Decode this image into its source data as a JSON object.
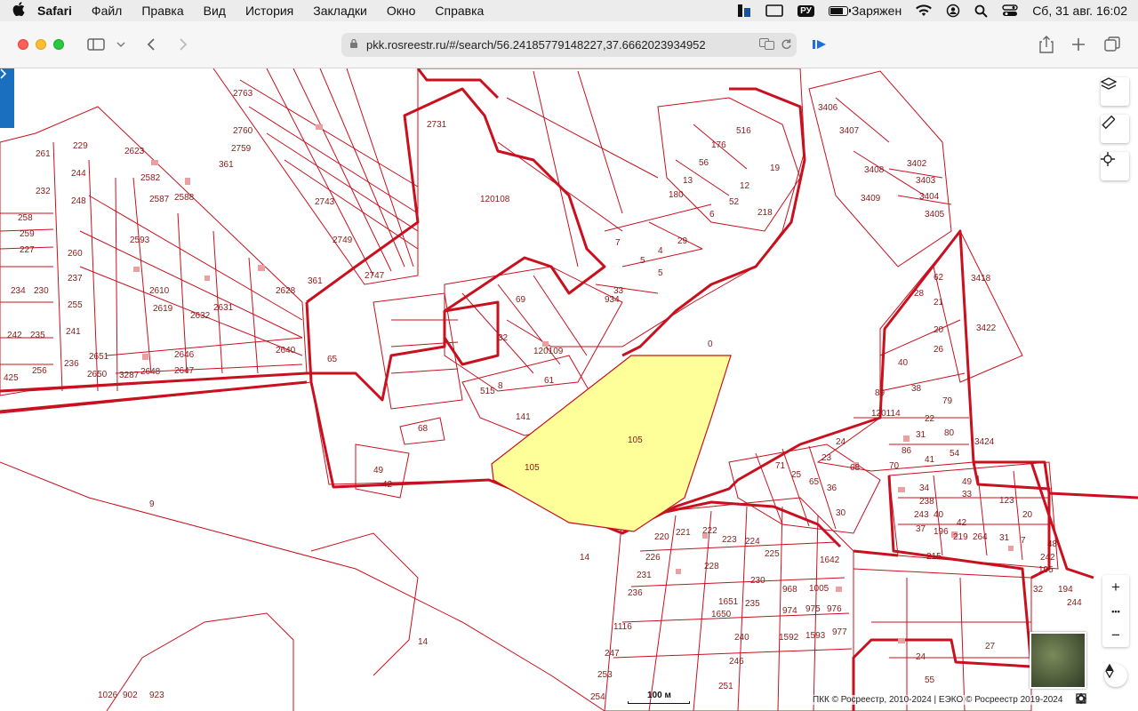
{
  "menubar": {
    "apple": "",
    "app_name": "Safari",
    "items": [
      "Файл",
      "Правка",
      "Вид",
      "История",
      "Закладки",
      "Окно",
      "Справка"
    ],
    "input_source": "РУ",
    "battery_status": "Заряжен",
    "battery_level": 0.85,
    "datetime": "Сб, 31 авг.  16:02"
  },
  "toolbar": {
    "url": "pkk.rosreestr.ru/#/search/56.24185779148227,37.6662023934952",
    "back": "‹",
    "forward": "›"
  },
  "map": {
    "highlighted_parcel": {
      "fill": "#ffff99",
      "labels": [
        "105",
        "105"
      ]
    },
    "quarter_labels": [
      "120108",
      "120109",
      "120114"
    ],
    "scale_label": "100 м",
    "copyright": "ПКК © Росреестр, 2010-2024 | ЕЭКО © Росреестр 2019-2024",
    "border_color": "#c8101e",
    "controls": {
      "zoom_in": "+",
      "more": "•••",
      "zoom_out": "−"
    }
  }
}
